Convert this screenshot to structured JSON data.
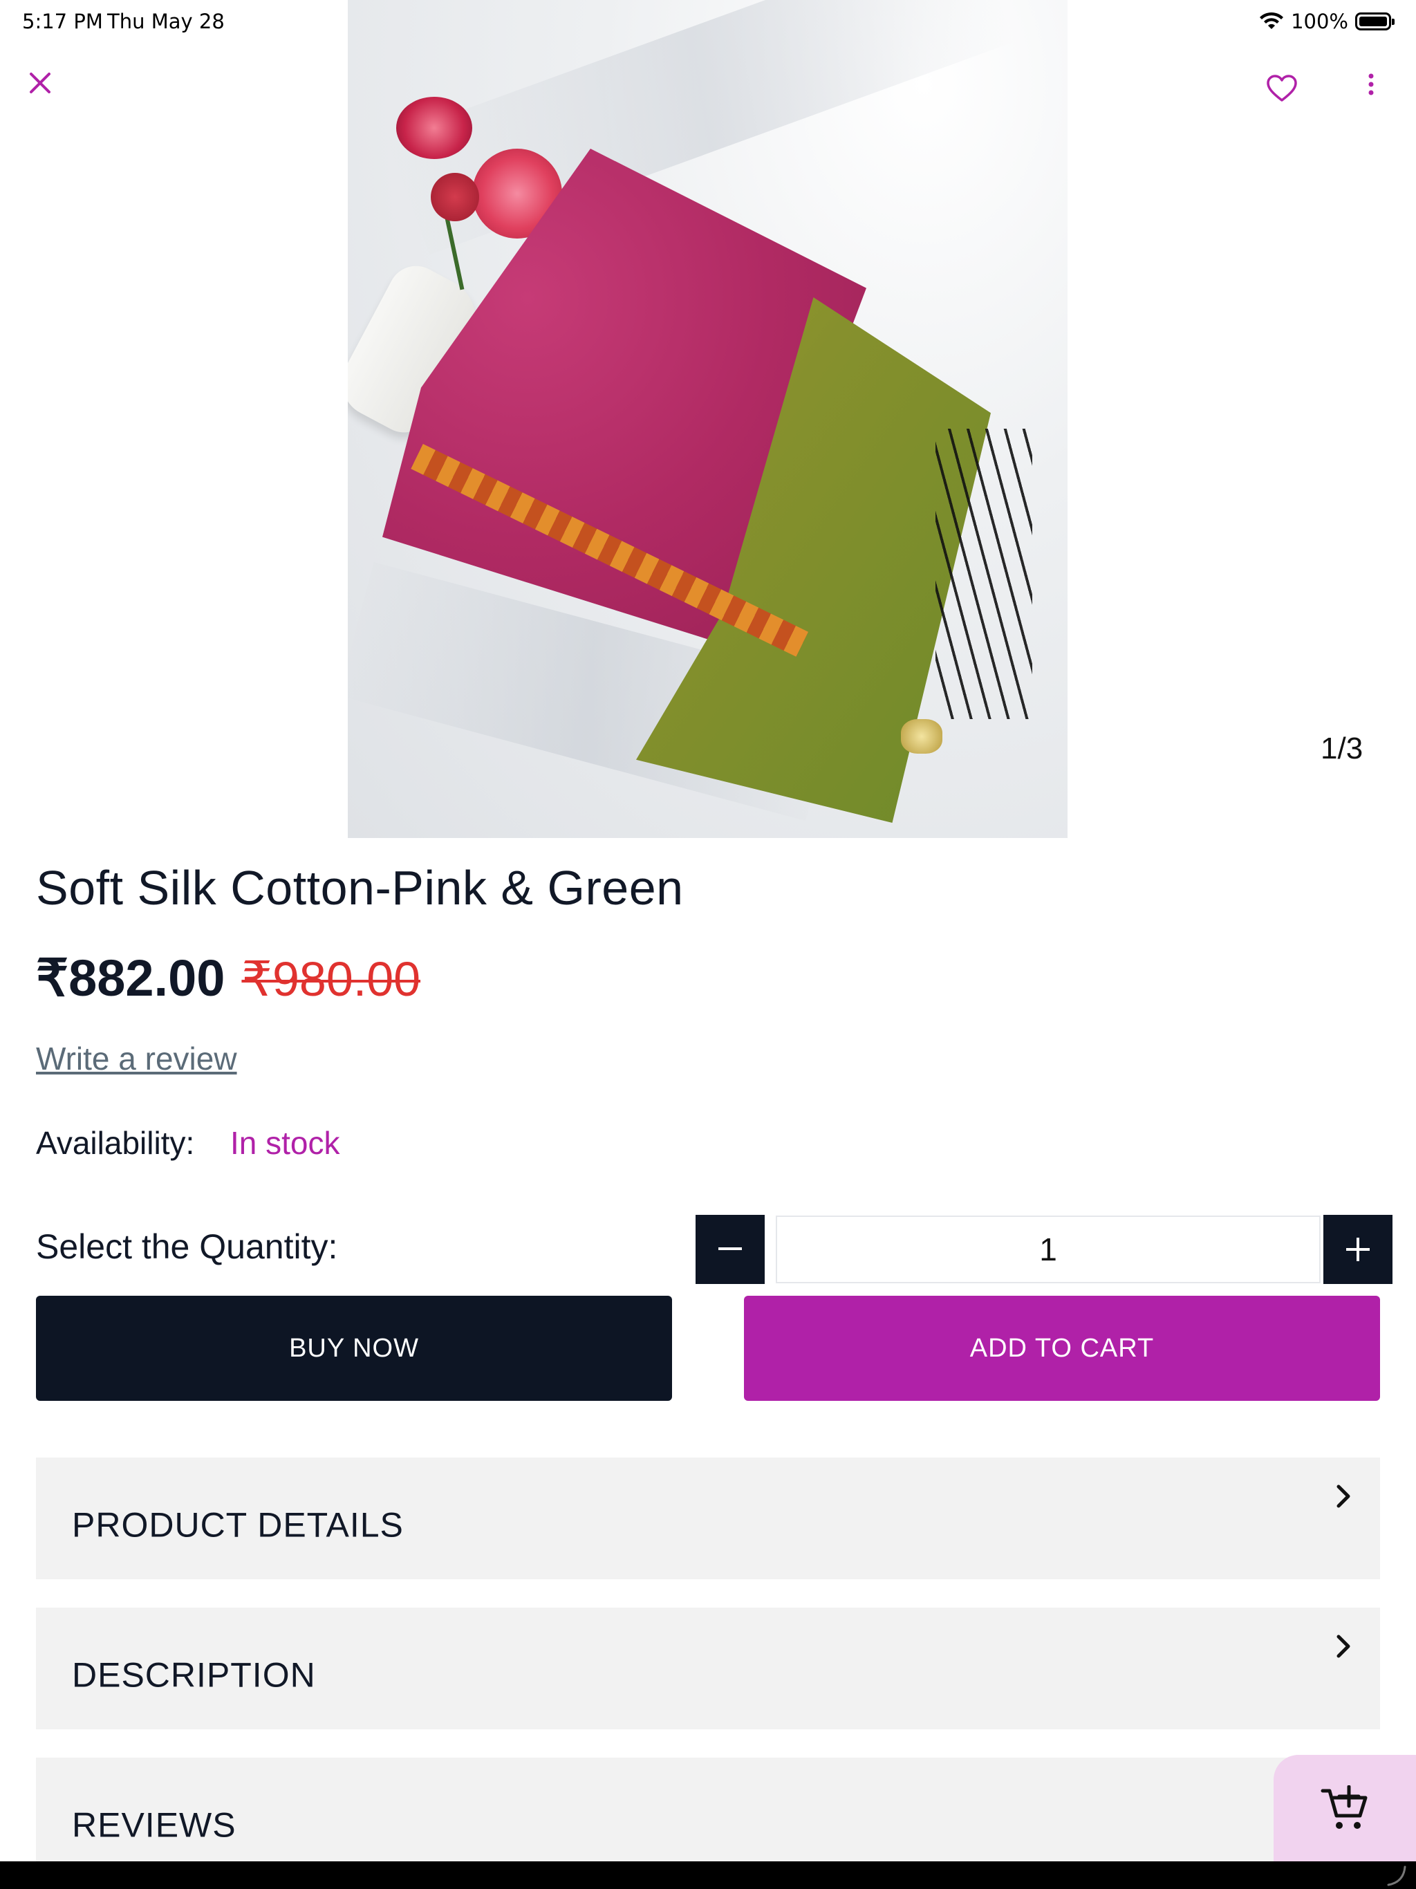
{
  "status_bar": {
    "time": "5:17 PM",
    "date": "Thu May 28",
    "battery": "100%"
  },
  "image_viewer": {
    "counter": "1/3",
    "current_image": 1,
    "total_images": 3
  },
  "product": {
    "title": "Soft Silk Cotton-Pink & Green",
    "price_current": "₹882.00",
    "price_original": "₹980.00",
    "review_link": "Write a review",
    "availability_label": "Availability:",
    "availability_value": "In stock"
  },
  "quantity": {
    "label": "Select the Quantity:",
    "value": "1"
  },
  "actions": {
    "buy_now": "BUY NOW",
    "add_to_cart": "ADD TO CART"
  },
  "sections": [
    {
      "label": "PRODUCT DETAILS"
    },
    {
      "label": "DESCRIPTION"
    },
    {
      "label": "REVIEWS"
    }
  ],
  "colors": {
    "accent": "#b021a8",
    "dark": "#0d1524",
    "strike_price": "#e0322f",
    "fab_bg": "#f1d3ef",
    "section_bg": "#f2f2f2"
  },
  "icons": {
    "close": "close-icon",
    "favorite": "heart-icon",
    "more": "more-vertical-icon",
    "minus": "minus-icon",
    "plus": "plus-icon",
    "chevron": "chevron-right-icon",
    "add_to_cart_fab": "cart-add-icon"
  }
}
